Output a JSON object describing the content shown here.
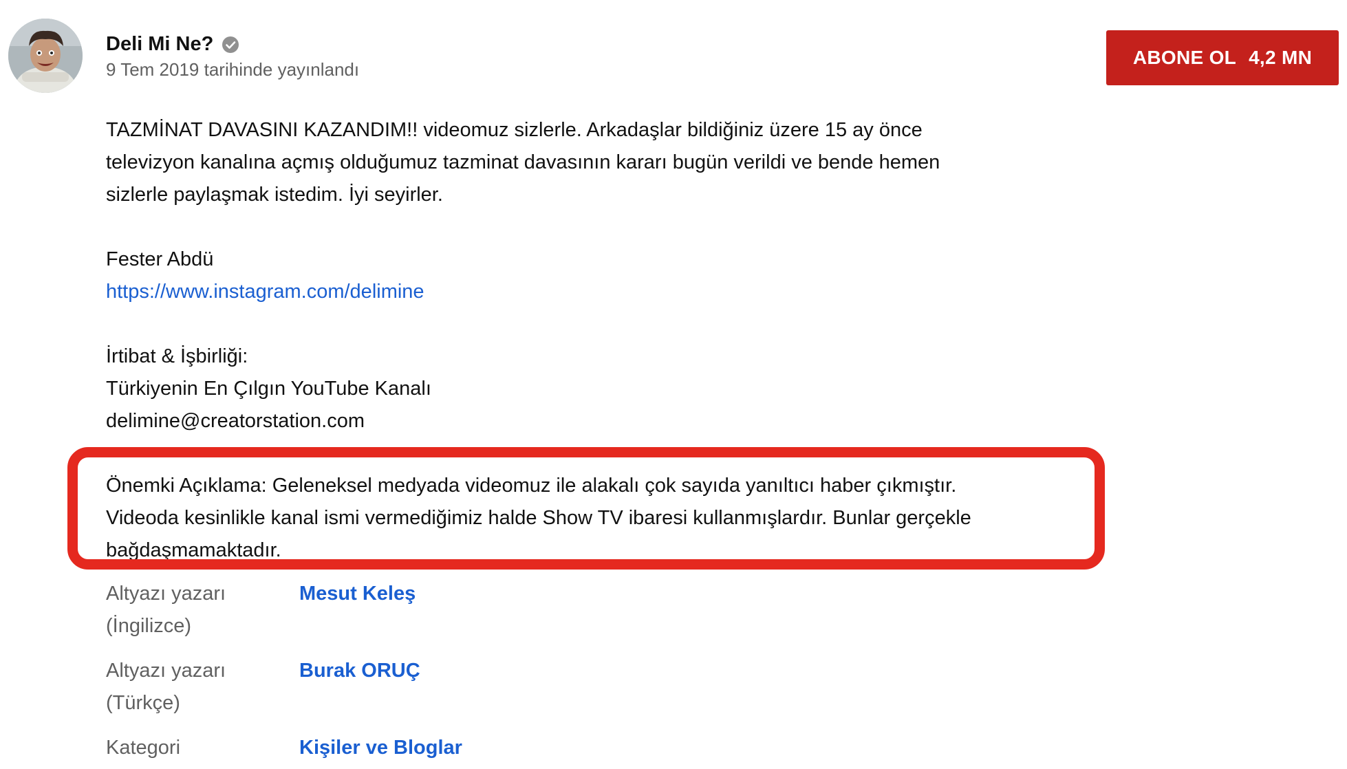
{
  "channel": {
    "name": "Deli Mi Ne?",
    "verified_icon": "check-circle-icon",
    "published": "9 Tem 2019 tarihinde yayınlandı",
    "avatar_icon": "avatar-photo"
  },
  "subscribe": {
    "label": "ABONE OL",
    "count": "4,2 MN",
    "color": "#c4211c"
  },
  "description": {
    "line1": "TAZMİNAT DAVASINI KAZANDIM!!  videomuz sizlerle. Arkadaşlar bildiğiniz üzere 15 ay önce",
    "line2": "televizyon kanalına açmış olduğumuz tazminat davasının kararı bugün verildi ve bende hemen",
    "line3": "sizlerle paylaşmak istedim. İyi seyirler.",
    "name": "Fester Abdü",
    "link": "https://www.instagram.com/delimine",
    "contact_title": "İrtibat & İşbirliği:",
    "contact_line": "Türkiyenin En Çılgın YouTube Kanalı",
    "email": "delimine@creatorstation.com",
    "notice1": "Önemki Açıklama: Geleneksel medyada videomuz ile alakalı çok sayıda yanıltıcı haber çıkmıştır.",
    "notice2": "Videoda kesinlikle kanal ismi vermediğimiz halde Show TV ibaresi kullanmışlardır. Bunlar gerçekle",
    "notice3": "bağdaşmamaktadır."
  },
  "highlight_color": "#e5291f",
  "metadata": [
    {
      "label1": "Altyazı yazarı",
      "label2": "(İngilizce)",
      "value": "Mesut Keleş"
    },
    {
      "label1": "Altyazı yazarı",
      "label2": "(Türkçe)",
      "value": "Burak ORUÇ"
    },
    {
      "label1": "Kategori",
      "label2": "",
      "value": "Kişiler ve Bloglar"
    }
  ]
}
